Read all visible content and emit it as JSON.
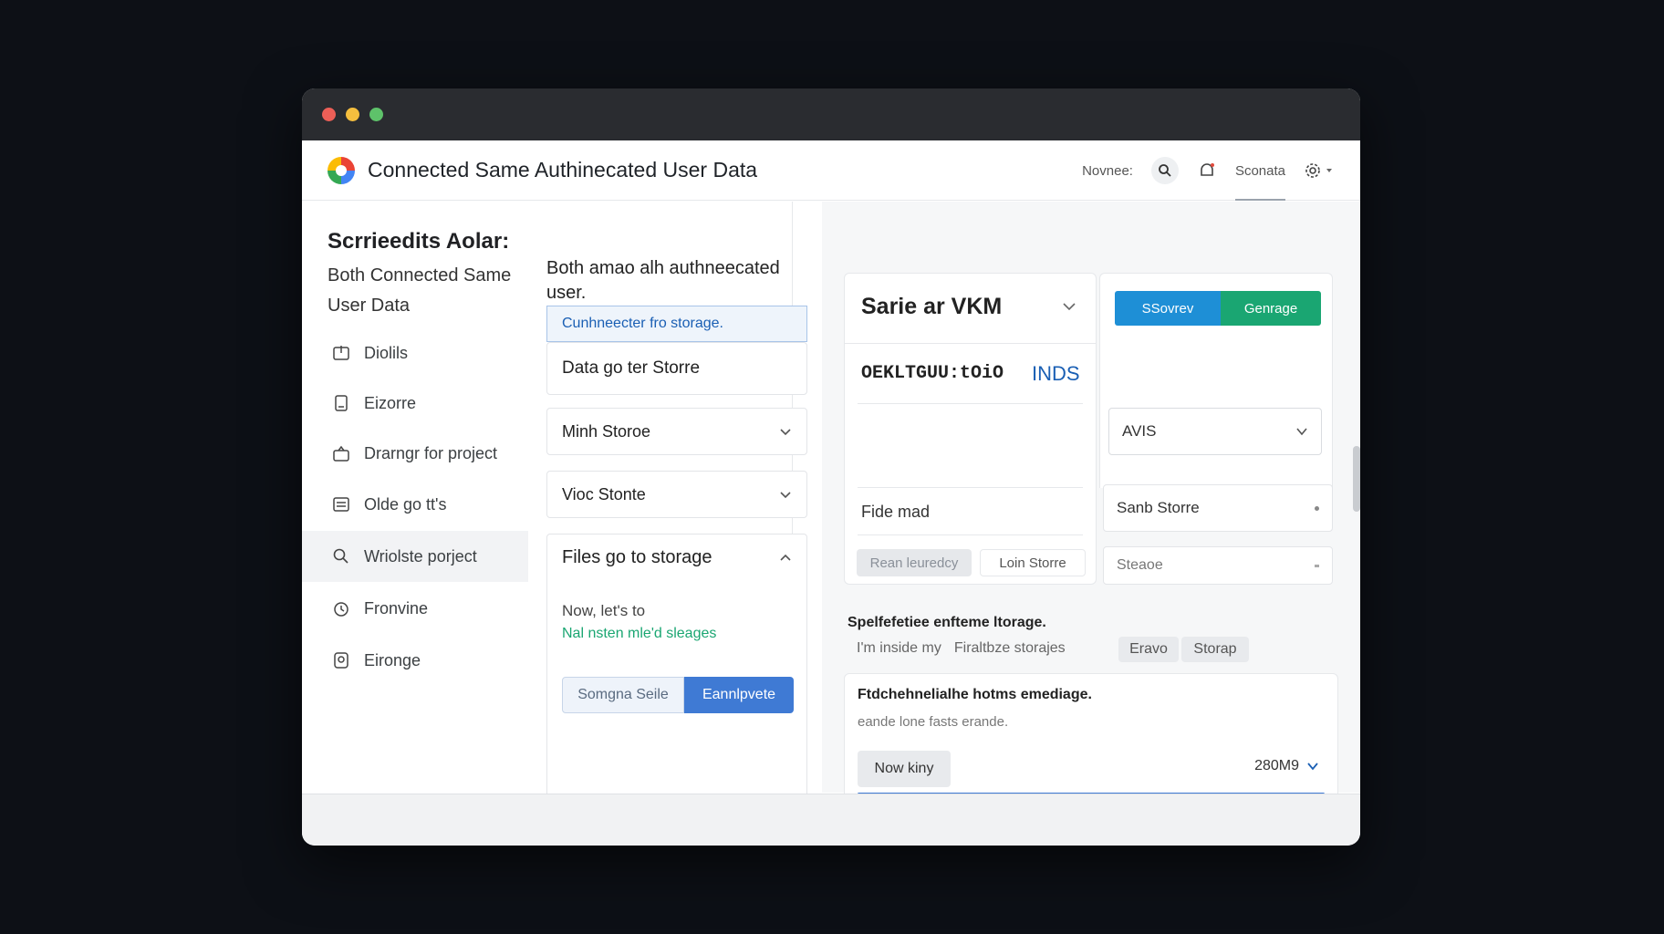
{
  "window": {
    "traffic_lights": {
      "close": "#ec5f57",
      "minimize": "#f4be3e",
      "maximize": "#5ec26a"
    }
  },
  "header": {
    "title": "Connected Same Authinecated User Data",
    "user_label": "Novnee:",
    "link_label": "Sconata",
    "icons": [
      "search-icon",
      "bell-icon",
      "gear-icon"
    ]
  },
  "sidebar": {
    "heading": "Scrrieedits Aolar:",
    "subheading": "Both Connected Same User Data",
    "items": [
      {
        "label": "Diolils",
        "icon": "folder-icon"
      },
      {
        "label": "Eizorre",
        "icon": "file-icon"
      },
      {
        "label": "Drarngr for project",
        "icon": "upload-icon"
      },
      {
        "label": "Olde go tt's",
        "icon": "list-icon"
      },
      {
        "label": "Wriolste porject",
        "icon": "search-icon",
        "active": true
      },
      {
        "label": "Fronvine",
        "icon": "clock-icon"
      },
      {
        "label": "Eironge",
        "icon": "storage-icon"
      }
    ]
  },
  "column2": {
    "title": "Both amao alh authneecated user.",
    "info": "Cunhneecter fro storage.",
    "data_row": "Data go ter Storre",
    "dropdown1": "Minh Storoe",
    "dropdown2": "Vioc Stonte",
    "section": {
      "title": "Files go to storage",
      "text": "Now, let's to",
      "link": "Nal nsten mle'd sleages",
      "secondary_btn": "Somgna Seile",
      "primary_btn": "Eannlpvete"
    }
  },
  "main": {
    "panel_left": {
      "title": "Sarie ar VKM",
      "code": "OEKLTGUU:tOiO",
      "code_tag": "INDS",
      "row": "Fide mad",
      "btn_disabled": "Rean leuredcy",
      "btn_text": "Loin Storre"
    },
    "panel_right": {
      "btn_blue": "SSovrev",
      "btn_green": "Genrage",
      "select": "AVIS",
      "row1": "Sanb Storre",
      "row2": "Steaoe"
    },
    "section": {
      "title": "Spelfefetiee enfteme ltorage.",
      "text_prefix": "I'm inside my",
      "text_suffix": "Firaltbze storajes",
      "chip1": "Eravo",
      "chip2": "Storap"
    },
    "card": {
      "title": "Ftdchehnelialhe hotms emediage.",
      "subtitle": "eande lone fasts erande.",
      "button": "Now kiny",
      "size": "280M9"
    },
    "colors": {
      "primary": "#3f7ad4",
      "green": "#1aa672",
      "blue": "#1e8fd6"
    }
  }
}
